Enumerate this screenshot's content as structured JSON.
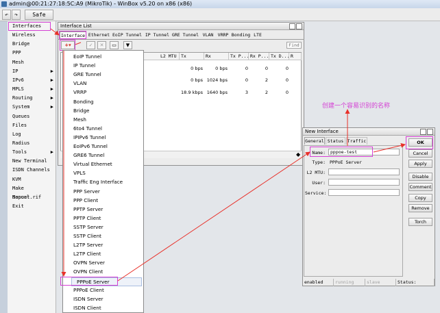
{
  "app": {
    "title": "admin@00:21:27:18:5C:A9 (MikroTik) - WinBox v5.20 on x86 (x86)"
  },
  "toolbar": {
    "undo": "↶",
    "redo": "↷",
    "safe_mode": "Safe Mode"
  },
  "sidebar": {
    "items": [
      {
        "label": "Interfaces",
        "sub": false
      },
      {
        "label": "Wireless",
        "sub": false
      },
      {
        "label": "Bridge",
        "sub": false
      },
      {
        "label": "PPP",
        "sub": false
      },
      {
        "label": "Mesh",
        "sub": false
      },
      {
        "label": "IP",
        "sub": true
      },
      {
        "label": "IPv6",
        "sub": true
      },
      {
        "label": "MPLS",
        "sub": true
      },
      {
        "label": "Routing",
        "sub": true
      },
      {
        "label": "System",
        "sub": true
      },
      {
        "label": "Queues",
        "sub": false
      },
      {
        "label": "Files",
        "sub": false
      },
      {
        "label": "Log",
        "sub": false
      },
      {
        "label": "Radius",
        "sub": false
      },
      {
        "label": "Tools",
        "sub": true
      },
      {
        "label": "New Terminal",
        "sub": false
      },
      {
        "label": "ISDN Channels",
        "sub": false
      },
      {
        "label": "KVM",
        "sub": false
      },
      {
        "label": "Make Supout.rif",
        "sub": false
      },
      {
        "label": "Manual",
        "sub": false
      },
      {
        "label": "Exit",
        "sub": false
      }
    ],
    "arrow": "▶"
  },
  "interface_list": {
    "title": "Interface List",
    "tabs": [
      "Interface",
      "Ethernet",
      "EoIP Tunnel",
      "IP Tunnel",
      "GRE Tunnel",
      "VLAN",
      "VRRP",
      "Bonding",
      "LTE"
    ],
    "find": "Find",
    "buttons": {
      "add": "+▾",
      "check": "✓",
      "cross": "✕",
      "copy": "▭",
      "filter": "▼"
    },
    "columns": [
      "L2 MTU",
      "Tx",
      "Rx",
      "Tx P...",
      "Rx P...",
      "Tx D...",
      "R"
    ],
    "rows": [
      {
        "tx": "0 bps",
        "rx": "0 bps",
        "txp": "0",
        "rxp": "0",
        "txd": "0"
      },
      {
        "tx": "0 bps",
        "rx": "1024 bps",
        "txp": "0",
        "rxp": "2",
        "txd": "0"
      },
      {
        "tx": "18.9 kbps",
        "rx": "1640 bps",
        "txp": "3",
        "rxp": "2",
        "txd": "0"
      }
    ],
    "scroll_marker": "◆"
  },
  "add_menu": {
    "items": [
      "EoIP Tunnel",
      "IP Tunnel",
      "GRE Tunnel",
      "VLAN",
      "VRRP",
      "Bonding",
      "Bridge",
      "Mesh",
      "6to4 Tunnel",
      "IPIPv6 Tunnel",
      "EoIPv6 Tunnel",
      "GRE6 Tunnel",
      "Virtual Ethernet",
      "VPLS",
      "Traffic Eng Interface",
      "PPP Server",
      "PPP Client",
      "PPTP Server",
      "PPTP Client",
      "SSTP Server",
      "SSTP Client",
      "L2TP Server",
      "L2TP Client",
      "OVPN Server",
      "OVPN Client",
      "PPPoE Server",
      "PPPoE Client",
      "ISDN Server",
      "ISDN Client"
    ],
    "selected": "PPPoE Server"
  },
  "new_interface": {
    "title": "New Interface",
    "tabs": [
      "General",
      "Status",
      "Traffic"
    ],
    "fields": {
      "name_label": "Name:",
      "name_value": "pppoe-test",
      "type_label": "Type:",
      "type_value": "PPPoE Server",
      "l2mtu_label": "L2 MTU:",
      "l2mtu_value": "",
      "user_label": "User:",
      "user_value": "",
      "service_label": "Service:",
      "service_value": ""
    },
    "buttons": [
      "OK",
      "Cancel",
      "Apply",
      "Disable",
      "Comment",
      "Copy",
      "Remove",
      "Torch"
    ],
    "status": [
      "enabled",
      "running",
      "slave",
      "Status:"
    ]
  },
  "annotation": {
    "text": "创建一个容易识别的名称",
    "color": "#d43fd4"
  },
  "colors": {
    "highlight": "#d43fd4",
    "arrow": "#e8312a"
  }
}
